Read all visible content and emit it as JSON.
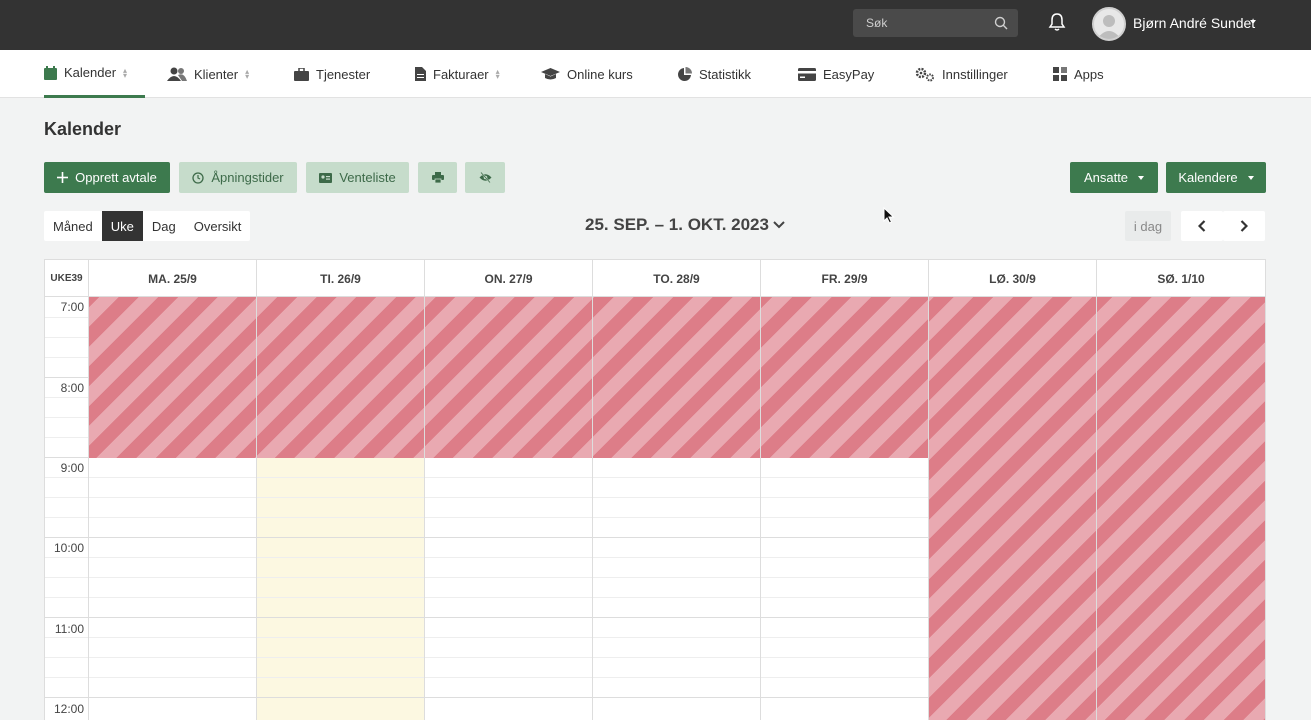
{
  "search": {
    "placeholder": "Søk"
  },
  "user": {
    "name": "Bjørn André Sundet"
  },
  "nav": [
    {
      "label": "Kalender",
      "icon": "calendar-icon"
    },
    {
      "label": "Klienter",
      "icon": "users-icon"
    },
    {
      "label": "Tjenester",
      "icon": "briefcase-icon"
    },
    {
      "label": "Fakturaer",
      "icon": "file-icon"
    },
    {
      "label": "Online kurs",
      "icon": "graduation-cap-icon"
    },
    {
      "label": "Statistikk",
      "icon": "pie-chart-icon"
    },
    {
      "label": "EasyPay",
      "icon": "credit-card-icon"
    },
    {
      "label": "Innstillinger",
      "icon": "gears-icon"
    },
    {
      "label": "Apps",
      "icon": "grid-icon"
    }
  ],
  "page": {
    "title": "Kalender"
  },
  "toolbar": {
    "create": "Opprett avtale",
    "hours": "Åpningstider",
    "waitlist": "Venteliste",
    "staff": "Ansatte",
    "calendars": "Kalendere"
  },
  "views": [
    "Måned",
    "Uke",
    "Dag",
    "Oversikt"
  ],
  "active_view": "Uke",
  "range": "25. SEP. – 1. OKT. 2023",
  "today_label": "i dag",
  "calendar": {
    "week": "UKE39",
    "days": [
      "MA. 25/9",
      "TI. 26/9",
      "ON. 27/9",
      "TO. 28/9",
      "FR. 29/9",
      "LØ. 30/9",
      "SØ. 1/10"
    ],
    "times": [
      "7:00",
      "8:00",
      "9:00",
      "10:00",
      "11:00",
      "12:00"
    ],
    "highlighted_day": "TI. 26/9",
    "colors": {
      "closed_stripe_dark": "#dd7d88",
      "closed_stripe_light": "#e9a9b1",
      "today_bg": "#fcf8e1"
    }
  },
  "colors": {
    "topbar": "#333333",
    "primary": "#3d7a4e",
    "primary_light": "#c6dccb"
  }
}
